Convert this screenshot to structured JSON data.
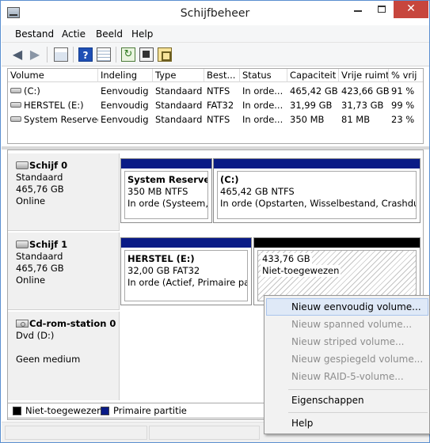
{
  "window": {
    "title": "Schijfbeheer"
  },
  "menubar": {
    "items": [
      "Bestand",
      "Actie",
      "Beeld",
      "Help"
    ]
  },
  "volume_table": {
    "columns": [
      "Volume",
      "Indeling",
      "Type",
      "Best...",
      "Status",
      "Capaciteit",
      "Vrije ruimte",
      "% vrij"
    ],
    "rows": [
      {
        "volume": "(C:)",
        "indeling": "Eenvoudig",
        "type": "Standaard",
        "fs": "NTFS",
        "status": "In orde...",
        "capaciteit": "465,42 GB",
        "vrij": "423,66 GB",
        "pct": "91 %"
      },
      {
        "volume": "HERSTEL (E:)",
        "indeling": "Eenvoudig",
        "type": "Standaard",
        "fs": "FAT32",
        "status": "In orde...",
        "capaciteit": "31,99 GB",
        "vrij": "31,73 GB",
        "pct": "99 %"
      },
      {
        "volume": "System Reserved",
        "indeling": "Eenvoudig",
        "type": "Standaard",
        "fs": "NTFS",
        "status": "In orde...",
        "capaciteit": "350 MB",
        "vrij": "81 MB",
        "pct": "23 %"
      }
    ]
  },
  "disks": [
    {
      "name": "Schijf 0",
      "kind": "Standaard",
      "size": "465,76 GB",
      "state": "Online",
      "partitions": [
        {
          "name": "System Reserved",
          "detail": "350 MB NTFS",
          "status": "In orde (Systeem, A"
        },
        {
          "name": "(C:)",
          "detail": "465,42 GB NTFS",
          "status": "In orde (Opstarten, Wisselbestand, Crashdump,"
        }
      ]
    },
    {
      "name": "Schijf 1",
      "kind": "Standaard",
      "size": "465,76 GB",
      "state": "Online",
      "partitions": [
        {
          "name": "HERSTEL  (E:)",
          "detail": "32,00 GB FAT32",
          "status": "In orde (Actief, Primaire partit"
        },
        {
          "name": "",
          "detail": "433,76 GB",
          "status": "Niet-toegewezen"
        }
      ]
    },
    {
      "name": "Cd-rom-station 0",
      "kind": "Dvd (D:)",
      "size": "",
      "state": "Geen medium"
    }
  ],
  "legend": {
    "unallocated": "Niet-toegewezen",
    "primary": "Primaire partitie"
  },
  "context_menu": {
    "items": [
      {
        "label": "Nieuw eenvoudig volume...",
        "enabled": true
      },
      {
        "label": "Nieuw spanned volume...",
        "enabled": false
      },
      {
        "label": "Nieuw striped volume...",
        "enabled": false
      },
      {
        "label": "Nieuw gespiegeld volume...",
        "enabled": false
      },
      {
        "label": "Nieuw RAID-5-volume...",
        "enabled": false
      },
      {
        "label": "Eigenschappen",
        "enabled": true
      },
      {
        "label": "Help",
        "enabled": true
      }
    ]
  },
  "colors": {
    "primary_partition": "#0a1b86",
    "unallocated": "#000000",
    "menu_highlight": "#dfe9f7"
  },
  "icons": [
    "app-icon",
    "back-arrow-icon",
    "forward-arrow-icon",
    "console-tree-icon",
    "help-icon",
    "list-view-icon",
    "refresh-icon",
    "properties-icon",
    "disk-icon",
    "drive-icon",
    "cdrom-icon"
  ]
}
